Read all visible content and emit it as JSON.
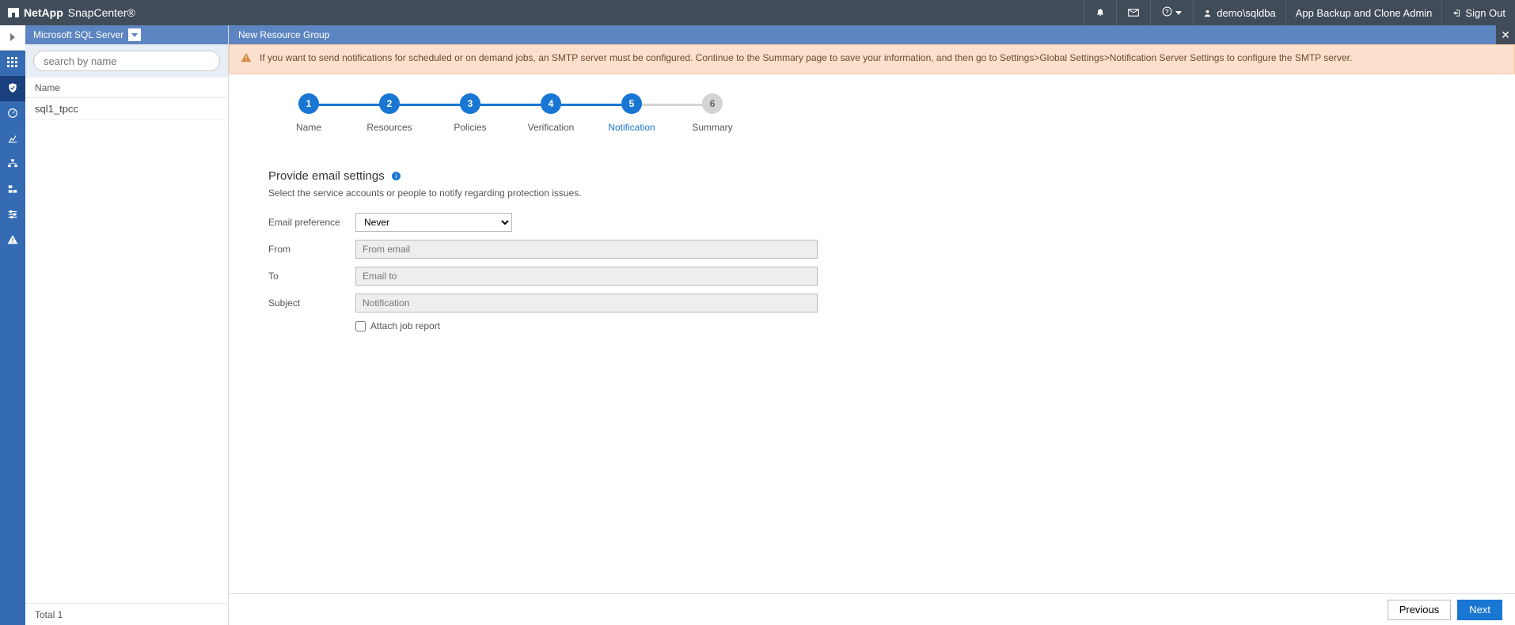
{
  "topbar": {
    "brand_company": "NetApp",
    "brand_app": "SnapCenter®",
    "user": "demo\\sqldba",
    "role": "App Backup and Clone Admin",
    "signout": "Sign Out"
  },
  "resource_panel": {
    "plugin_label": "Microsoft SQL Server",
    "search_placeholder": "search by name",
    "col_name": "Name",
    "rows": [
      "sql1_tpcc"
    ],
    "footer": "Total 1"
  },
  "main": {
    "title": "New Resource Group",
    "alert": "If you want to send notifications for scheduled or on demand jobs, an SMTP server must be configured. Continue to the Summary page to save your information, and then go to Settings>Global Settings>Notification Server Settings to configure the SMTP server.",
    "steps": [
      {
        "n": "1",
        "label": "Name",
        "state": "done"
      },
      {
        "n": "2",
        "label": "Resources",
        "state": "done"
      },
      {
        "n": "3",
        "label": "Policies",
        "state": "done"
      },
      {
        "n": "4",
        "label": "Verification",
        "state": "done"
      },
      {
        "n": "5",
        "label": "Notification",
        "state": "current"
      },
      {
        "n": "6",
        "label": "Summary",
        "state": "pending"
      }
    ],
    "section_title": "Provide email settings",
    "section_sub": "Select the service accounts or people to notify regarding protection issues.",
    "form": {
      "email_pref_label": "Email preference",
      "email_pref_value": "Never",
      "from_label": "From",
      "from_placeholder": "From email",
      "to_label": "To",
      "to_placeholder": "Email to",
      "subject_label": "Subject",
      "subject_placeholder": "Notification",
      "attach_label": "Attach job report"
    },
    "buttons": {
      "prev": "Previous",
      "next": "Next"
    }
  }
}
